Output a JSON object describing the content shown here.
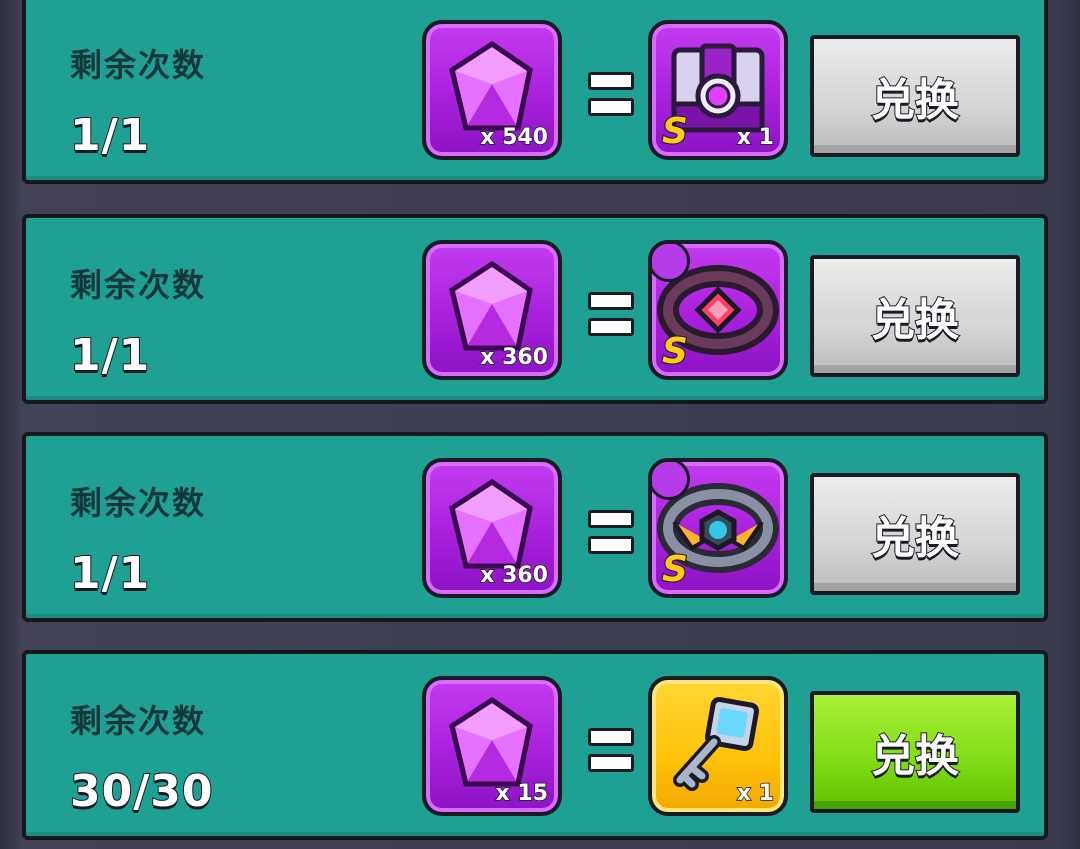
{
  "remaining_label": "剩余次数",
  "exchange_label": "兑换",
  "equals_icon": "equals-icon",
  "rows": [
    {
      "remaining": "1/1",
      "cost": {
        "icon": "purple-gem-icon",
        "qty": "x 540"
      },
      "reward": {
        "icon": "chest-item-icon",
        "grade": "S",
        "qty": "x 1"
      },
      "button_state": "disabled",
      "button_color": "#d4d4d4"
    },
    {
      "remaining": "1/1",
      "cost": {
        "icon": "purple-gem-icon",
        "qty": "x 360"
      },
      "reward": {
        "icon": "dark-ring-icon",
        "grade": "S",
        "qty": ""
      },
      "button_state": "disabled",
      "button_color": "#d4d4d4"
    },
    {
      "remaining": "1/1",
      "cost": {
        "icon": "purple-gem-icon",
        "qty": "x 360"
      },
      "reward": {
        "icon": "mech-ring-icon",
        "grade": "S",
        "qty": ""
      },
      "button_state": "disabled",
      "button_color": "#d4d4d4"
    },
    {
      "remaining": "30/30",
      "cost": {
        "icon": "purple-gem-icon",
        "qty": "x 15"
      },
      "reward": {
        "icon": "key-icon",
        "grade": "",
        "qty": "x 1"
      },
      "button_state": "enabled",
      "button_color": "#7fdc14"
    }
  ],
  "colors": {
    "row_bg": "#1ea192",
    "gem_slot": "#a820dc",
    "gold_slot": "#ffc20a",
    "label_text": "#15373a"
  }
}
